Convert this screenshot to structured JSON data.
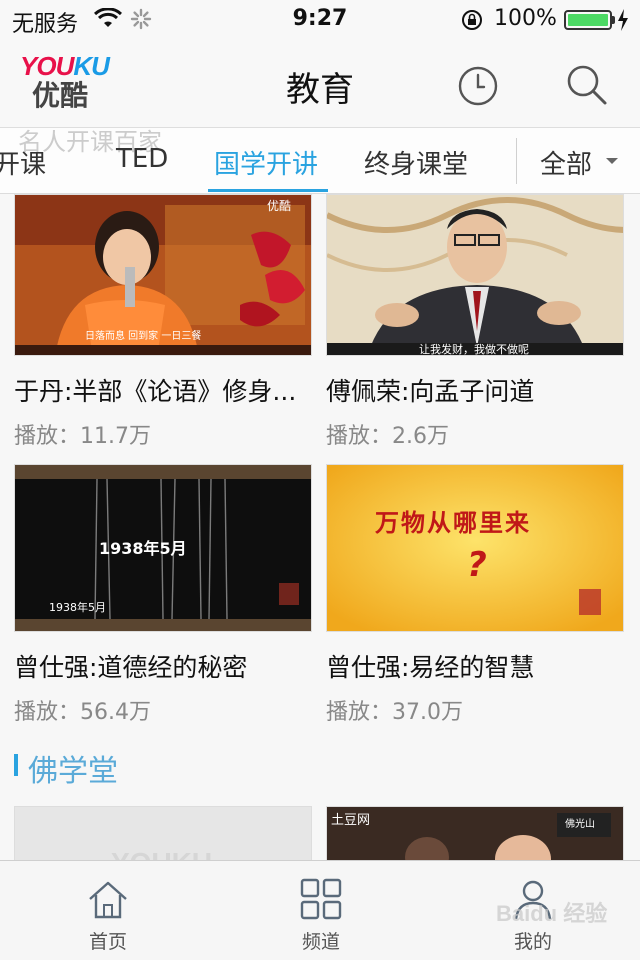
{
  "status_bar": {
    "carrier": "无服务",
    "time": "9:27",
    "battery_percent": "100%",
    "battery_level": 1.0
  },
  "nav": {
    "logo_latin": "YOUKU",
    "logo_cn": "优酷",
    "title": "教育",
    "history_icon": "clock-icon",
    "search_icon": "search-icon"
  },
  "tabs": {
    "items": [
      {
        "label": "开课"
      },
      {
        "label": "TED"
      },
      {
        "label": "国学开讲",
        "active": true
      },
      {
        "label": "终身课堂"
      }
    ],
    "all_label": "全部",
    "ghost_label": "名人开课百家"
  },
  "videos": [
    {
      "title": "于丹:半部《论语》修身...",
      "plays": "播放：11.7万",
      "thumb_caption": "日落而息 回到家 一日三餐",
      "thumb_logo": "优酷"
    },
    {
      "title": "傅佩荣:向孟子问道",
      "plays": "播放：2.6万",
      "thumb_caption": "让我发财，我做不做呢"
    },
    {
      "title": "曾仕强:道德经的秘密",
      "plays": "播放：56.4万",
      "thumb_text": "1938年5月",
      "thumb_caption": "1938年5月"
    },
    {
      "title": "曾仕强:易经的智慧",
      "plays": "播放：37.0万",
      "thumb_text": "万物从哪里来",
      "thumb_mark": "?"
    }
  ],
  "section": {
    "title": "佛学堂"
  },
  "section_thumbs": {
    "left_placeholder": "YOUKU",
    "right_logo": "土豆网",
    "right_badge": "佛光山"
  },
  "bottom_tabs": [
    {
      "label": "首页",
      "icon": "home-icon"
    },
    {
      "label": "频道",
      "icon": "grid-icon"
    },
    {
      "label": "我的",
      "icon": "user-icon"
    }
  ],
  "watermark": "Baidu 经验",
  "colors": {
    "accent": "#2aa3e0",
    "logo_red": "#e8114a",
    "logo_blue": "#1a9be6",
    "battery": "#4cd964"
  }
}
